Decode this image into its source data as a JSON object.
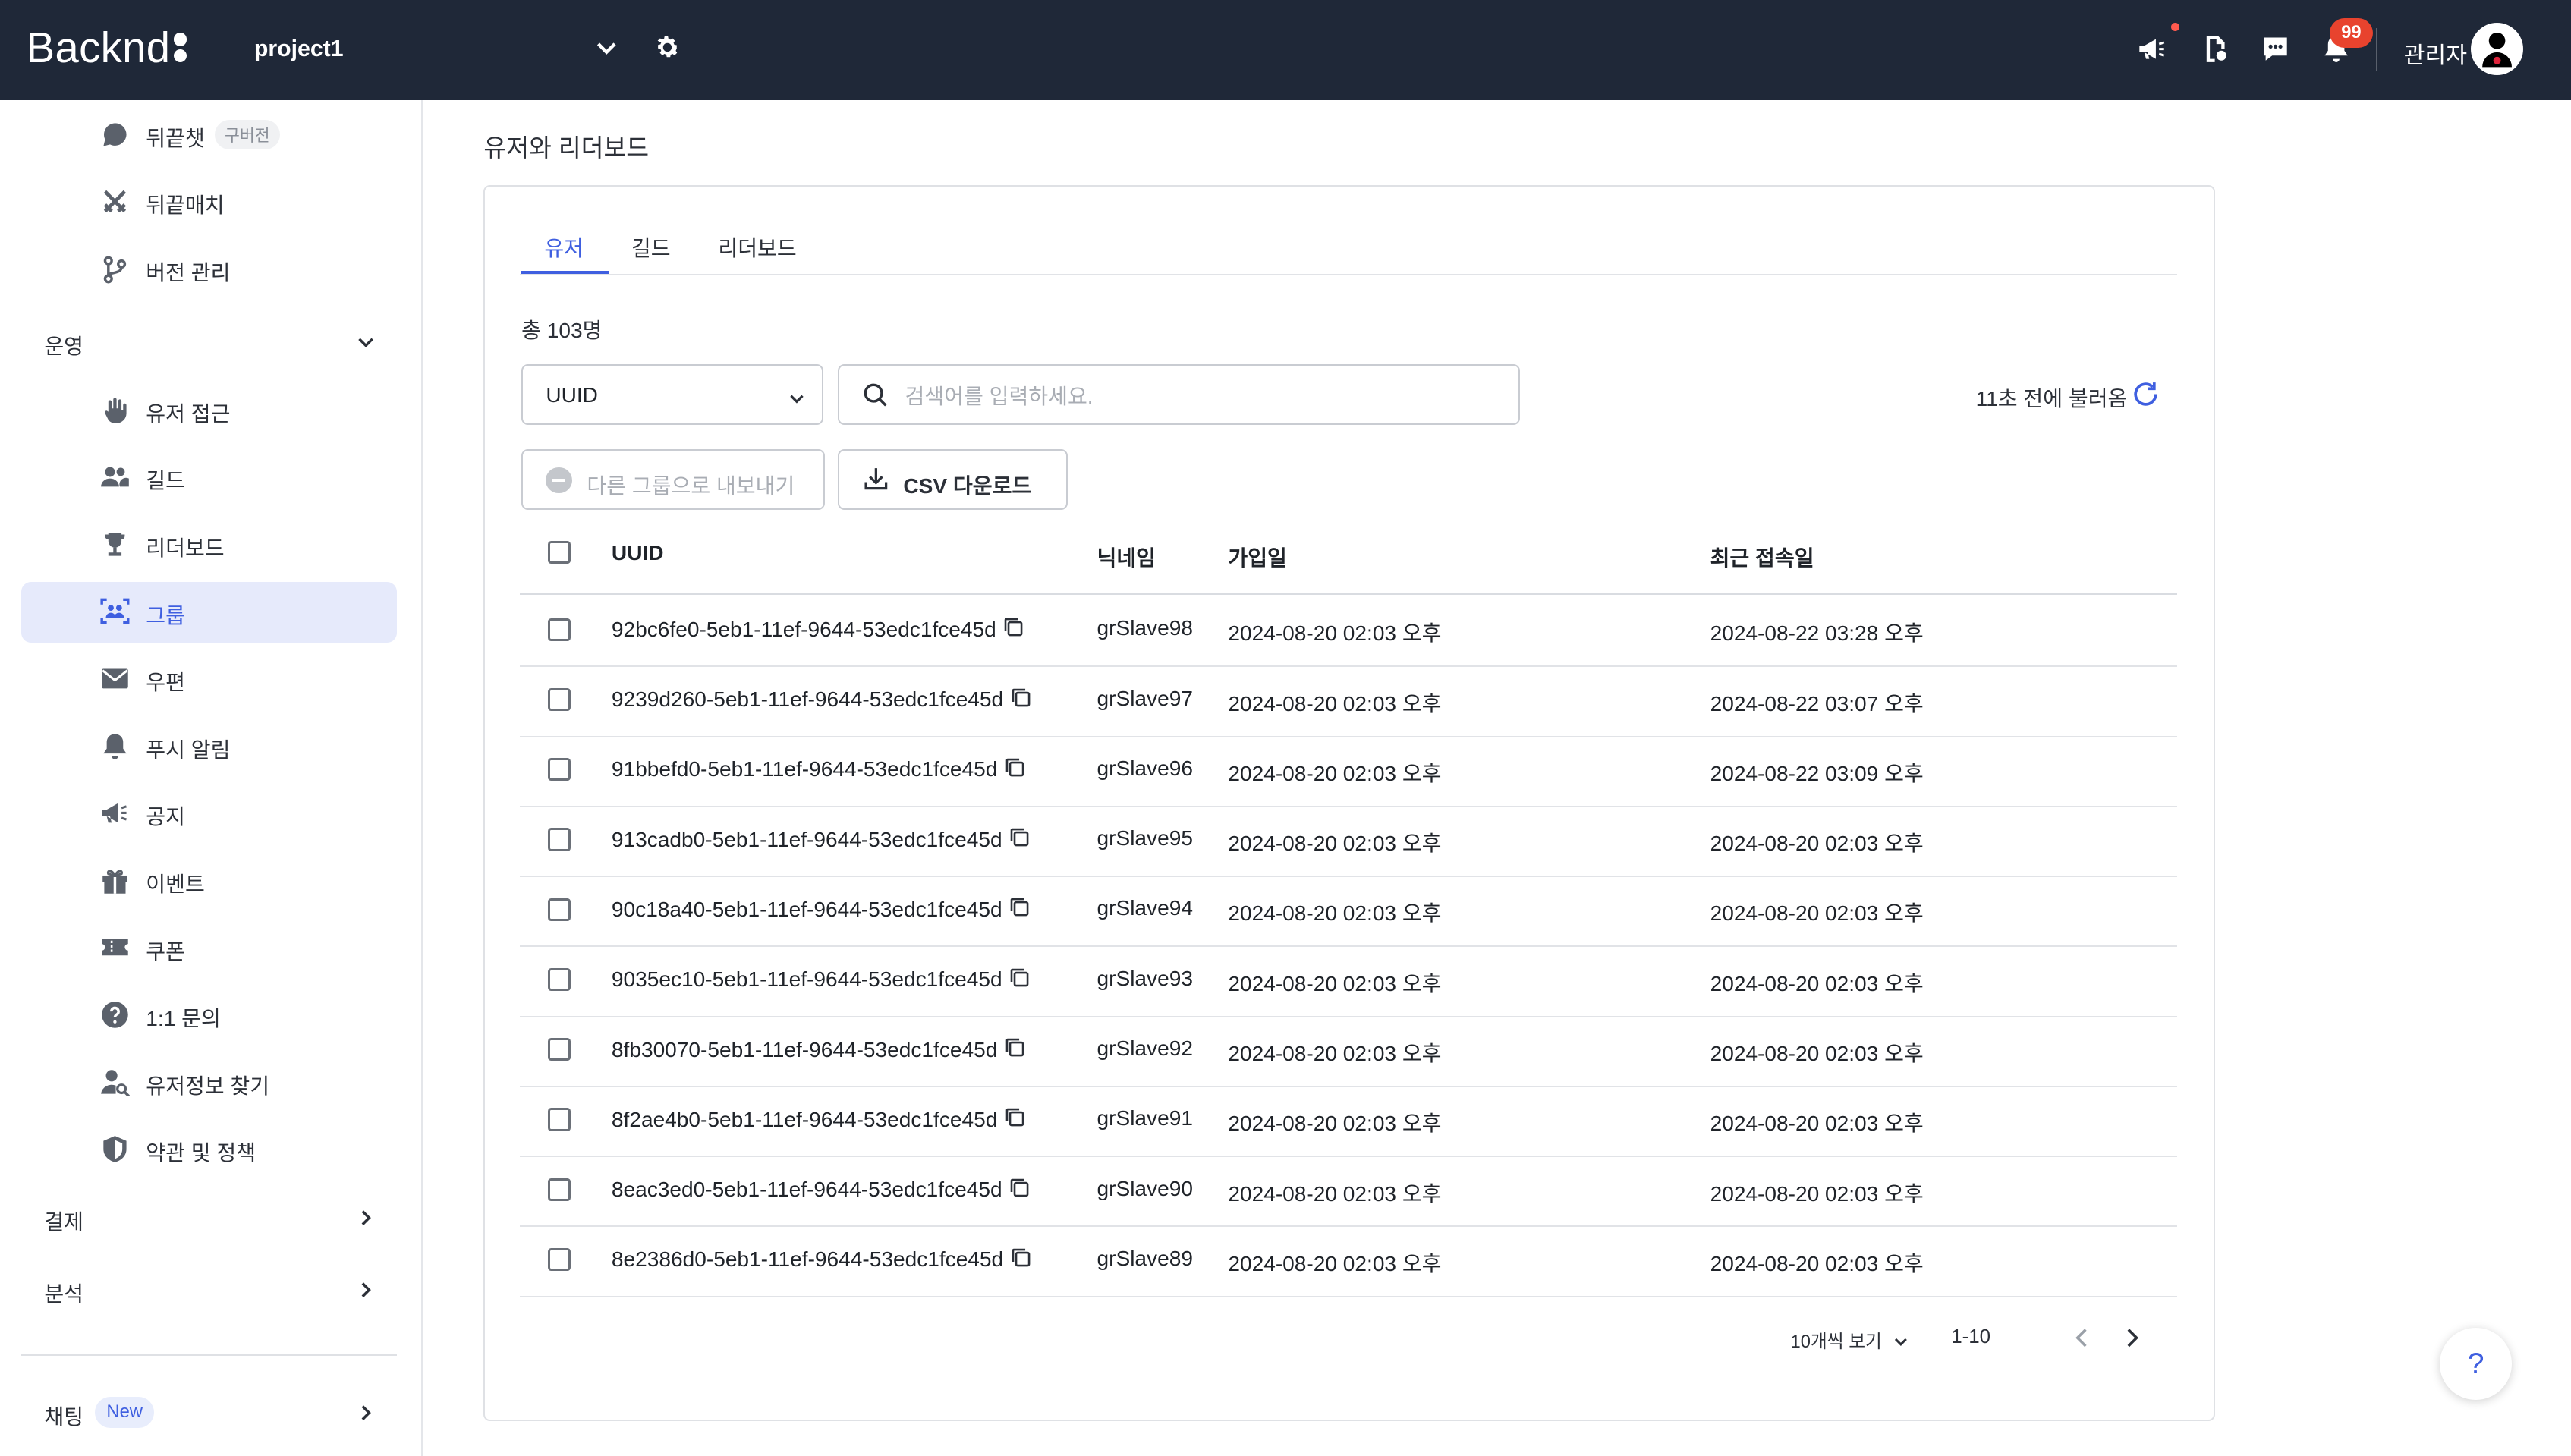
{
  "header": {
    "logo_text": "Backnd",
    "project_name": "project1",
    "notification_count": "99",
    "admin_label": "관리자"
  },
  "sidebar": {
    "items_top": [
      {
        "label": "뒤끝챗",
        "badge": "구버전",
        "icon": "chat-icon"
      },
      {
        "label": "뒤끝매치",
        "icon": "swords-icon"
      },
      {
        "label": "버전 관리",
        "icon": "branch-icon"
      }
    ],
    "section_operation": "운영",
    "items_operation": [
      {
        "label": "유저 접근",
        "icon": "hand-icon"
      },
      {
        "label": "길드",
        "icon": "users-icon"
      },
      {
        "label": "리더보드",
        "icon": "trophy-icon"
      },
      {
        "label": "그룹",
        "icon": "group-icon",
        "active": true
      },
      {
        "label": "우편",
        "icon": "mail-icon"
      },
      {
        "label": "푸시 알림",
        "icon": "bell-icon"
      },
      {
        "label": "공지",
        "icon": "megaphone-icon"
      },
      {
        "label": "이벤트",
        "icon": "gift-icon"
      },
      {
        "label": "쿠폰",
        "icon": "ticket-icon"
      },
      {
        "label": "1:1 문의",
        "icon": "question-icon"
      },
      {
        "label": "유저정보 찾기",
        "icon": "user-search-icon"
      },
      {
        "label": "약관 및 정책",
        "icon": "shield-icon"
      }
    ],
    "section_payment": "결제",
    "section_analytics": "분석",
    "section_chat": "채팅",
    "chat_badge": "New"
  },
  "page": {
    "title": "유저와 리더보드",
    "tabs": [
      "유저",
      "길드",
      "리더보드"
    ],
    "active_tab": "유저",
    "total": "총 103명",
    "search_field_value": "UUID",
    "search_placeholder": "검색어를 입력하세요.",
    "refresh_text": "11초 전에 불러옴",
    "export_button": "다른 그룹으로 내보내기",
    "csv_button": "CSV 다운로드",
    "accent_color": "#3f5fe0"
  },
  "table": {
    "columns": [
      "UUID",
      "닉네임",
      "가입일",
      "최근 접속일"
    ],
    "rows": [
      {
        "uuid": "92bc6fe0-5eb1-11ef-9644-53edc1fce45d",
        "nickname": "grSlave98",
        "joined": "2024-08-20 02:03 오후",
        "last_access": "2024-08-22 03:28 오후"
      },
      {
        "uuid": "9239d260-5eb1-11ef-9644-53edc1fce45d",
        "nickname": "grSlave97",
        "joined": "2024-08-20 02:03 오후",
        "last_access": "2024-08-22 03:07 오후"
      },
      {
        "uuid": "91bbefd0-5eb1-11ef-9644-53edc1fce45d",
        "nickname": "grSlave96",
        "joined": "2024-08-20 02:03 오후",
        "last_access": "2024-08-22 03:09 오후"
      },
      {
        "uuid": "913cadb0-5eb1-11ef-9644-53edc1fce45d",
        "nickname": "grSlave95",
        "joined": "2024-08-20 02:03 오후",
        "last_access": "2024-08-20 02:03 오후"
      },
      {
        "uuid": "90c18a40-5eb1-11ef-9644-53edc1fce45d",
        "nickname": "grSlave94",
        "joined": "2024-08-20 02:03 오후",
        "last_access": "2024-08-20 02:03 오후"
      },
      {
        "uuid": "9035ec10-5eb1-11ef-9644-53edc1fce45d",
        "nickname": "grSlave93",
        "joined": "2024-08-20 02:03 오후",
        "last_access": "2024-08-20 02:03 오후"
      },
      {
        "uuid": "8fb30070-5eb1-11ef-9644-53edc1fce45d",
        "nickname": "grSlave92",
        "joined": "2024-08-20 02:03 오후",
        "last_access": "2024-08-20 02:03 오후"
      },
      {
        "uuid": "8f2ae4b0-5eb1-11ef-9644-53edc1fce45d",
        "nickname": "grSlave91",
        "joined": "2024-08-20 02:03 오후",
        "last_access": "2024-08-20 02:03 오후"
      },
      {
        "uuid": "8eac3ed0-5eb1-11ef-9644-53edc1fce45d",
        "nickname": "grSlave90",
        "joined": "2024-08-20 02:03 오후",
        "last_access": "2024-08-20 02:03 오후"
      },
      {
        "uuid": "8e2386d0-5eb1-11ef-9644-53edc1fce45d",
        "nickname": "grSlave89",
        "joined": "2024-08-20 02:03 오후",
        "last_access": "2024-08-20 02:03 오후"
      }
    ]
  },
  "pagination": {
    "page_size_label": "10개씩 보기",
    "range": "1-10"
  },
  "help_button": "?"
}
